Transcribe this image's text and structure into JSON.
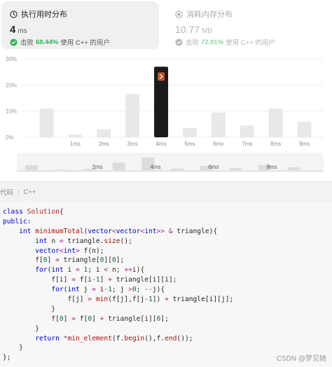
{
  "runtime_card": {
    "title": "执行用时分布",
    "value": "4",
    "unit": "ms",
    "beats_label": "击败",
    "beats_pct": "68.44%",
    "beats_suffix": "使用 C++ 的用户",
    "icon": "clock-icon",
    "check_icon": "check-circle-icon"
  },
  "memory_card": {
    "title": "消耗内存分布",
    "value": "10.77",
    "unit": "MB",
    "beats_label": "击败",
    "beats_pct": "72.91%",
    "beats_suffix": "使用 C++ 的用户",
    "icon": "memory-chip-icon",
    "check_icon": "check-circle-icon"
  },
  "colors": {
    "accent_green": "#2db55d",
    "bar_default": "#e8e8e8",
    "bar_selected": "#1a1a1a",
    "gridline": "#eeeeee"
  },
  "chart_data": {
    "type": "bar",
    "yticks": [
      "30%",
      "20%",
      "10%",
      "0%"
    ],
    "ylim": [
      0,
      30
    ],
    "categories": [
      "",
      "1ms",
      "2ms",
      "3ms",
      "4ms",
      "5ms",
      "6ms",
      "7ms",
      "8ms",
      "9ms"
    ],
    "values": [
      11,
      1,
      3,
      16.5,
      27,
      3.5,
      9.5,
      4.5,
      11,
      6
    ],
    "selected_index": 4,
    "selected_marker_icon": "user-avatar-icon",
    "grid": true,
    "overview": {
      "labels": [
        "2ms",
        "4ms",
        "6ms",
        "8ms"
      ],
      "values": [
        11,
        1,
        3,
        16.5,
        27,
        3.5,
        9.5,
        4.5,
        11,
        6
      ]
    }
  },
  "code_section": {
    "label_partial": "代码",
    "language": "C++"
  },
  "code_lines": [
    "class Solution{",
    "public:",
    "    int minimumTotal(vector<vector<int>> & triangle){",
    "        int n = triangle.size();",
    "        vector<int> f(n);",
    "        f[0] = triangle[0][0];",
    "        for(int i = 1; i < n; ++i){",
    "            f[i] = f[i-1] + triangle[i][i];",
    "            for(int j = i-1; j >0; --j){",
    "                f[j] = min(f[j],f[j-1]) + triangle[i][j];",
    "            }",
    "            f[0] = f[0] + triangle[i][0];",
    "        }",
    "        return *min_element(f.begin(),f.end());",
    "    }",
    "};"
  ],
  "watermark": "CSDN @梦见她"
}
